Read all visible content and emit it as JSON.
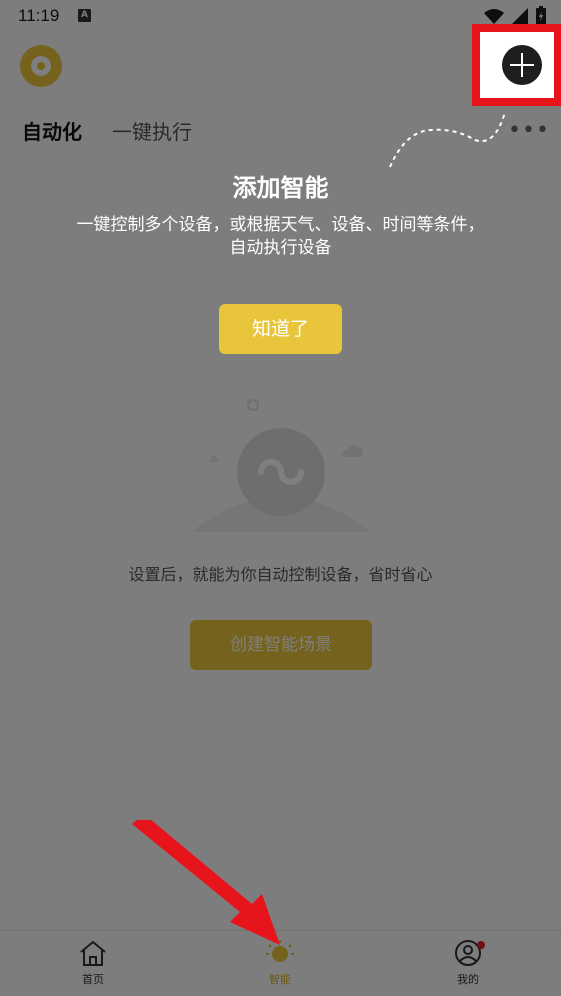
{
  "status_bar": {
    "time": "11:19",
    "notification_letter": "A"
  },
  "tabs": [
    {
      "label": "自动化",
      "active": true
    },
    {
      "label": "一键执行",
      "active": false
    }
  ],
  "empty_state": {
    "text": "设置后，就能为你自动控制设备，省时省心",
    "create_label": "创建智能场景"
  },
  "guide": {
    "title": "添加智能",
    "description": "一键控制多个设备，或根据天气、设备、时间等条件，自动执行设备",
    "got_it_label": "知道了"
  },
  "bottom_nav": [
    {
      "label": "首页",
      "icon": "home-icon",
      "active": false
    },
    {
      "label": "智能",
      "icon": "sun-icon",
      "active": true
    },
    {
      "label": "我的",
      "icon": "profile-icon",
      "active": false,
      "badge": true
    }
  ],
  "colors": {
    "accent": "#e8c53a",
    "highlight": "#e8141c",
    "overlay": "rgba(0,0,0,0.5)"
  }
}
